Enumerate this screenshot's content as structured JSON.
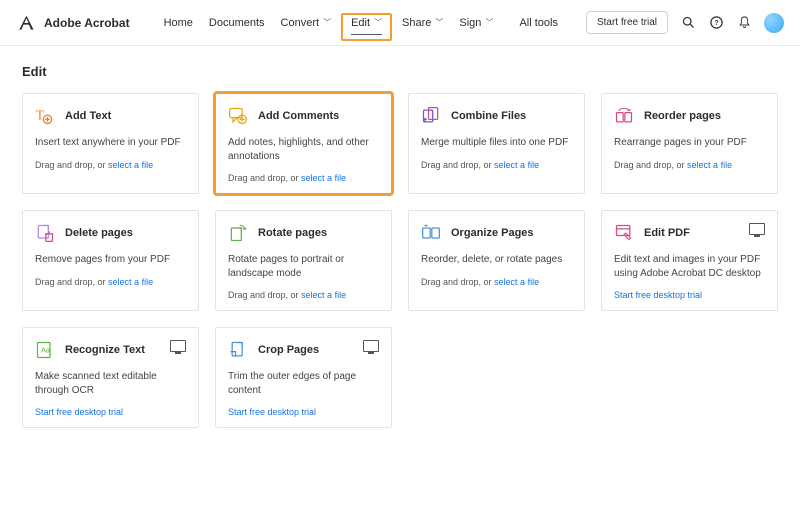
{
  "brand": {
    "name": "Adobe Acrobat"
  },
  "nav": {
    "home": "Home",
    "documents": "Documents",
    "convert": "Convert",
    "edit": "Edit",
    "share": "Share",
    "sign": "Sign",
    "alltools": "All tools"
  },
  "header": {
    "trial": "Start free trial"
  },
  "page": {
    "title": "Edit",
    "drag_prefix": "Drag and drop, or ",
    "select_file": "select a file",
    "desktop_trial": "Start free desktop trial"
  },
  "cards": {
    "add_text": {
      "title": "Add Text",
      "desc": "Insert text anywhere in your PDF"
    },
    "add_comments": {
      "title": "Add Comments",
      "desc": "Add notes, highlights, and other annotations"
    },
    "combine_files": {
      "title": "Combine Files",
      "desc": "Merge multiple files into one PDF"
    },
    "reorder_pages": {
      "title": "Reorder pages",
      "desc": "Rearrange pages in your PDF"
    },
    "delete_pages": {
      "title": "Delete pages",
      "desc": "Remove pages from your PDF"
    },
    "rotate_pages": {
      "title": "Rotate pages",
      "desc": "Rotate pages to portrait or landscape mode"
    },
    "organize_pages": {
      "title": "Organize Pages",
      "desc": "Reorder, delete, or rotate pages"
    },
    "edit_pdf": {
      "title": "Edit PDF",
      "desc": "Edit text and images in your PDF using Adobe Acrobat DC desktop"
    },
    "recognize_text": {
      "title": "Recognize Text",
      "desc": "Make scanned text editable through OCR"
    },
    "crop_pages": {
      "title": "Crop Pages",
      "desc": "Trim the outer edges of page content"
    }
  }
}
